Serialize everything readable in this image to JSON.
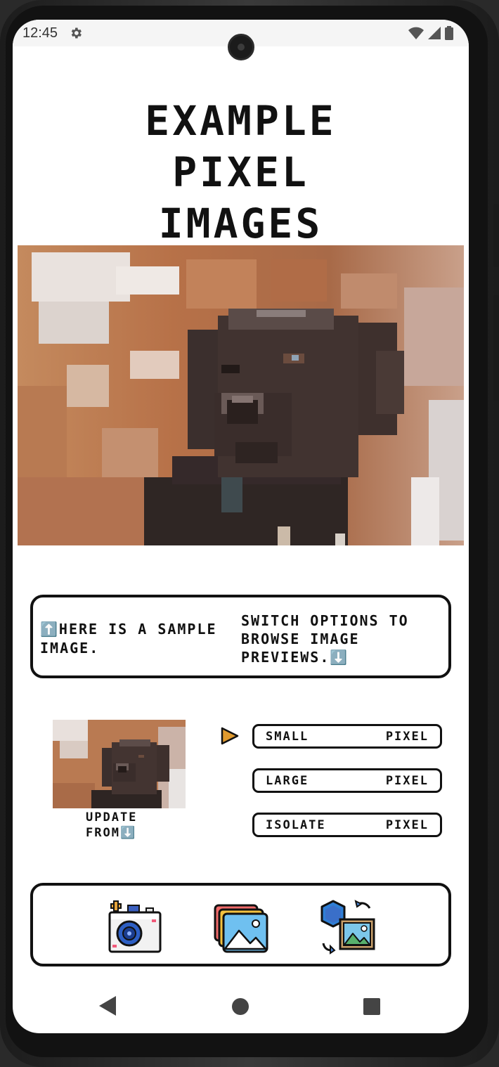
{
  "status_bar": {
    "time": "12:45",
    "icons": [
      "gear-icon",
      "wifi-icon",
      "signal-icon",
      "battery-icon"
    ]
  },
  "title": {
    "line1": "EXAMPLE",
    "line2": "PIXEL",
    "line3": "IMAGES"
  },
  "info": {
    "left_text": "⬆️HERE IS A SAMPLE IMAGE.",
    "right_text": "SWITCH OPTIONS TO BROWSE IMAGE PREVIEWS.⬇️"
  },
  "update": {
    "line1": "UPDATE",
    "line2": "FROM⬇️"
  },
  "options": [
    {
      "left": "SMALL",
      "right": "PIXEL",
      "selected": true
    },
    {
      "left": "LARGE",
      "right": "PIXEL",
      "selected": false
    },
    {
      "left": "ISOLATE",
      "right": "PIXEL",
      "selected": false
    }
  ],
  "toolbar": {
    "icons": [
      "camera-icon",
      "gallery-icon",
      "convert-image-icon"
    ]
  },
  "nav": {
    "icons": [
      "back-icon",
      "home-icon",
      "recents-icon"
    ]
  },
  "colors": {
    "selector_arrow": "#e09a2e",
    "outline": "#111111",
    "hero_bg": "#b8724a"
  }
}
